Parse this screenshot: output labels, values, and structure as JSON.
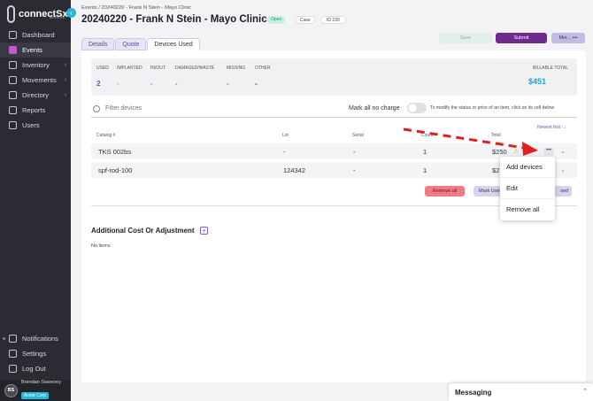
{
  "app": {
    "logo_text": "connectSx",
    "logo_sub": "MEDICAL",
    "collapse_glyph": "‹"
  },
  "sidebar": {
    "items": [
      {
        "label": "Dashboard",
        "icon": "dashboard-icon"
      },
      {
        "label": "Events",
        "icon": "calendar-icon",
        "active": true
      },
      {
        "label": "Inventory",
        "icon": "box-icon",
        "chevron": "›"
      },
      {
        "label": "Movements",
        "icon": "truck-icon",
        "chevron": "›"
      },
      {
        "label": "Directory",
        "icon": "directory-icon",
        "chevron": "›"
      },
      {
        "label": "Reports",
        "icon": "reports-icon"
      },
      {
        "label": "Users",
        "icon": "users-icon"
      }
    ],
    "bottom_items": [
      {
        "label": "Notifications",
        "icon": "bell-icon"
      },
      {
        "label": "Settings",
        "icon": "gear-icon"
      },
      {
        "label": "Log Out",
        "icon": "logout-icon"
      }
    ],
    "user": {
      "initials": "BS",
      "name": "Brendan Sweeney",
      "org": "Acme Corp"
    }
  },
  "header": {
    "breadcrumb": "Events / 20240220 - Frank N Stein - Mayo Clinic",
    "title": "20240220 - Frank N Stein - Mayo Clinic",
    "status_chip": "Open",
    "type_chip": "Case",
    "id_chip": "ID 230",
    "tabs": [
      {
        "label": "Details"
      },
      {
        "label": "Quote"
      },
      {
        "label": "Devices Used",
        "active": true
      }
    ],
    "save_label": "Save",
    "submit_label": "Submit",
    "more_label": "Mor...",
    "more_dots": "•••"
  },
  "summary": {
    "used_label": "USED",
    "used_value": "2",
    "implanted_label": "IMPLANTED",
    "implanted_value": "-",
    "inout_label": "IN/OUT",
    "inout_value": "-",
    "damaged_label": "DAMAGED/WASTE",
    "damaged_value": "-",
    "missing_label": "MISSING",
    "missing_value": "-",
    "other_label": "OTHER",
    "other_value": "-",
    "billable_label": "BILLABLE TOTAL",
    "billable_value": "$451",
    "colors": {
      "used": "#7a4bc9",
      "implanted": "#e8a44a",
      "inout": "#27b4d6",
      "damaged": "#e2504e",
      "missing": "#e2504e",
      "other": "#333333",
      "billable": "#1fa6d0"
    }
  },
  "filter": {
    "placeholder": "Filter devices",
    "no_charge_label": "Mark all no charge",
    "hint": "To modify the status or price of an item, click on its cell below"
  },
  "sort_label": "Newest first ↑↓",
  "table": {
    "headers": {
      "catalog": "Catalog #",
      "lot": "Lot",
      "serial": "Serial",
      "count": "Count",
      "total": "Total"
    },
    "rows": [
      {
        "catalog": "TKS 002bs",
        "lot": "-",
        "serial": "-",
        "count": "1",
        "total": "$250",
        "warning": "⚠"
      },
      {
        "catalog": "spf-rod-100",
        "lot": "124342",
        "serial": "-",
        "count": "1",
        "total": "$2"
      }
    ]
  },
  "actions": {
    "remove_all": "Remove all",
    "mark_used": "Mark Use",
    "used_right": "sed",
    "row_menu": "•••"
  },
  "dropdown": {
    "items": [
      "Add devices",
      "Edit",
      "Remove all"
    ]
  },
  "additional": {
    "title": "Additional Cost Or Adjustment",
    "plus": "+",
    "empty": "No items"
  },
  "messaging": {
    "label": "Messaging",
    "chevron": "⌃"
  },
  "annotation_color": "#e02020"
}
